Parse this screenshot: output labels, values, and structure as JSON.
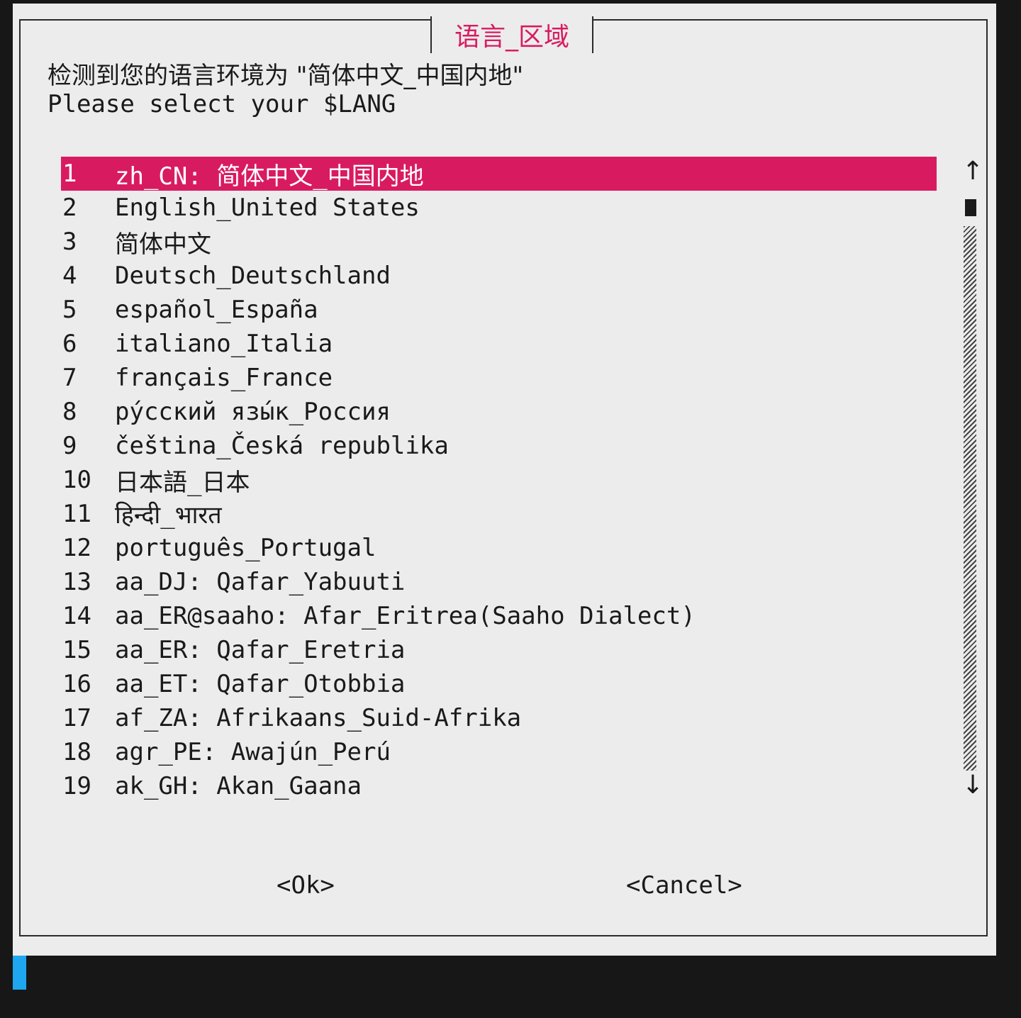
{
  "dialog": {
    "title": "语言_区域",
    "message_cn": "检测到您的语言环境为 \"简体中文_中国内地\"",
    "message_en": "Please select your $LANG"
  },
  "list": {
    "items": [
      {
        "num": "1",
        "label": "zh_CN: 简体中文_中国内地",
        "selected": true
      },
      {
        "num": "2",
        "label": "English_United States"
      },
      {
        "num": "3",
        "label": "简体中文"
      },
      {
        "num": "4",
        "label": "Deutsch_Deutschland"
      },
      {
        "num": "5",
        "label": "español_España"
      },
      {
        "num": "6",
        "label": "italiano_Italia"
      },
      {
        "num": "7",
        "label": "français_France"
      },
      {
        "num": "8",
        "label": "ру́сский язы́к_Россия"
      },
      {
        "num": "9",
        "label": "čeština_Česká republika"
      },
      {
        "num": "10",
        "label": "日本語_日本"
      },
      {
        "num": "11",
        "label": "हिन्दी_भारत"
      },
      {
        "num": "12",
        "label": "português_Portugal"
      },
      {
        "num": "13",
        "label": "aa_DJ: Qafar_Yabuuti"
      },
      {
        "num": "14",
        "label": "aa_ER@saaho: Afar_Eritrea(Saaho Dialect)"
      },
      {
        "num": "15",
        "label": "aa_ER: Qafar_Eretria"
      },
      {
        "num": "16",
        "label": "aa_ET: Qafar_Otobbia"
      },
      {
        "num": "17",
        "label": "af_ZA: Afrikaans_Suid-Afrika"
      },
      {
        "num": "18",
        "label": "agr_PE: Awajún_Perú"
      },
      {
        "num": "19",
        "label": "ak_GH: Akan_Gaana"
      }
    ]
  },
  "scrollbar": {
    "up_arrow": "↑",
    "down_arrow": "↓",
    "icons": {
      "up": "arrow-up-icon",
      "down": "arrow-down-icon"
    }
  },
  "buttons": {
    "ok": "<Ok>",
    "cancel": "<Cancel>"
  },
  "colors": {
    "accent": "#d81b60",
    "dialog_bg": "#ececec",
    "terminal_bg": "#171717",
    "cursor": "#1ea7f0"
  }
}
